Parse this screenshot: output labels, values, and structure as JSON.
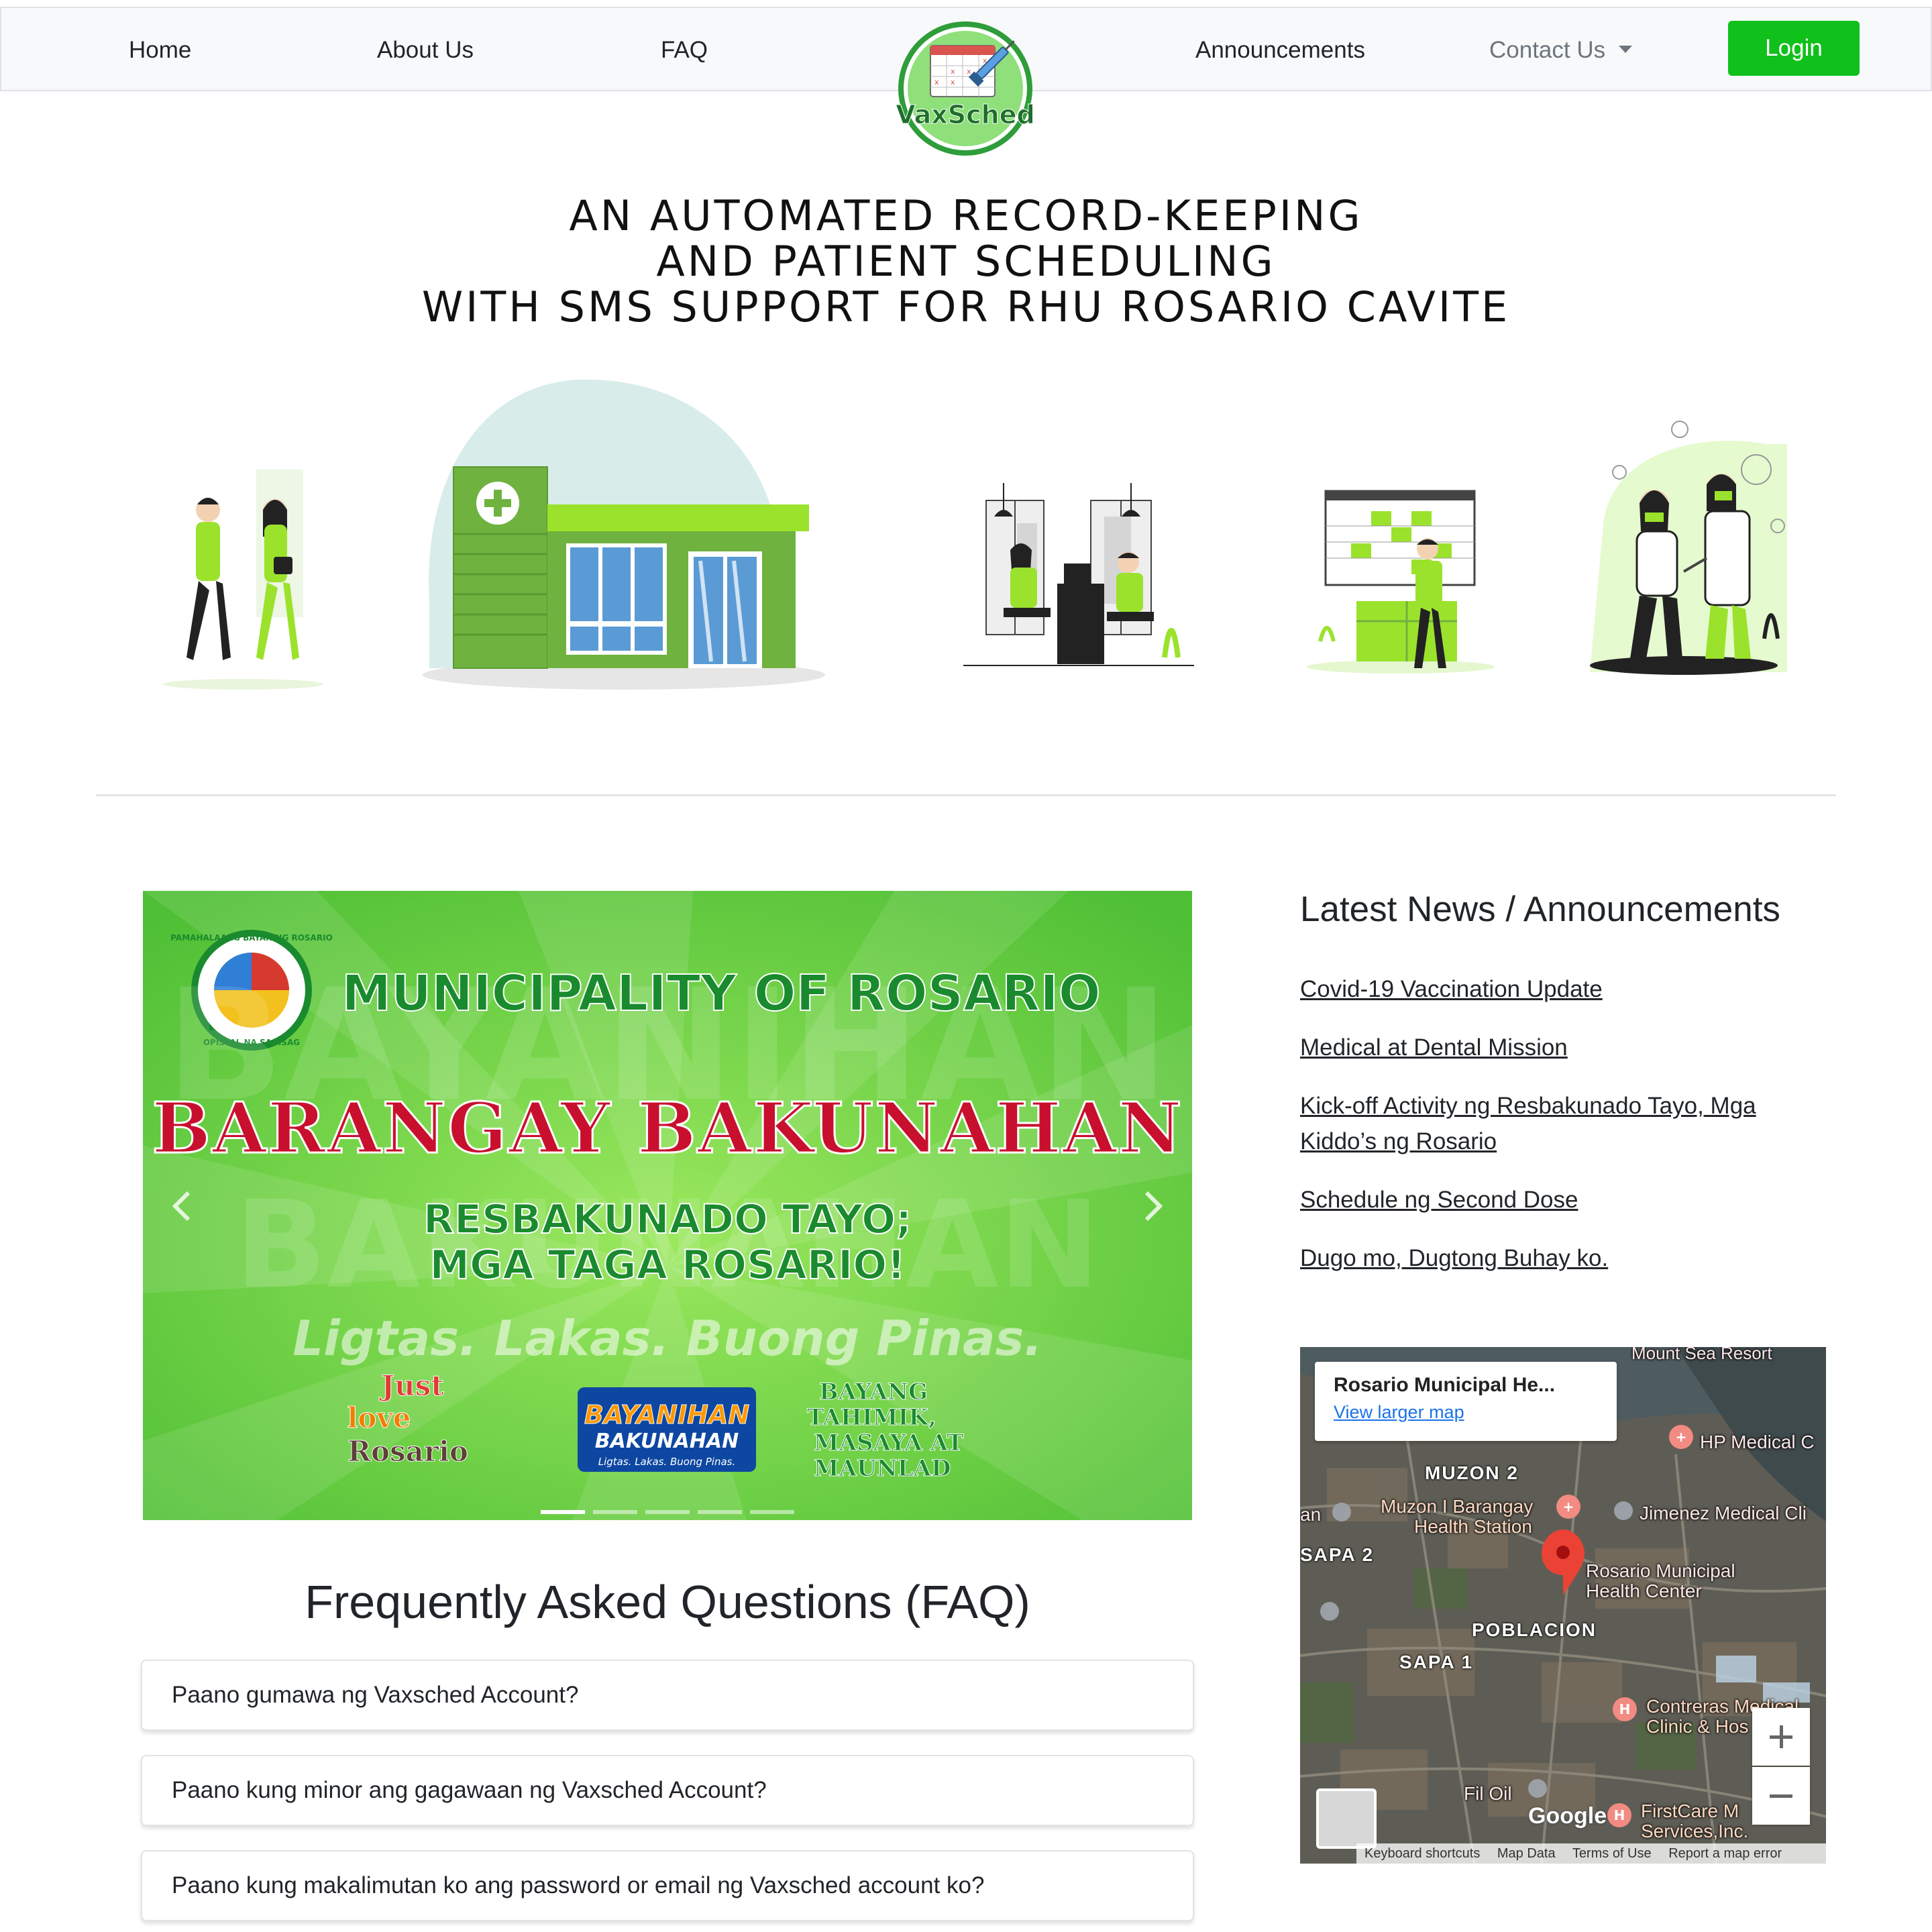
{
  "nav": {
    "home": "Home",
    "about": "About Us",
    "faq": "FAQ",
    "announcements": "Announcements",
    "contact": "Contact Us",
    "login": "Login"
  },
  "logo": {
    "text": "VaxSched"
  },
  "hero": {
    "line1": "AN AUTOMATED RECORD-KEEPING",
    "line2": "AND PATIENT SCHEDULING",
    "line3": "WITH SMS SUPPORT FOR RHU ROSARIO CAVITE"
  },
  "carousel": {
    "slide_count": 5,
    "active_slide": 1,
    "slide": {
      "header": "MUNICIPALITY OF ROSARIO",
      "seal_text_top": "PAMAHALAANG BAYAN NG ROSARIO",
      "seal_text_bottom": "OPISYAL NA SAGISAG",
      "headline": "BARANGAY BAKUNAHAN",
      "sub1": "RESBAKUNADO TAYO;",
      "sub2": "MGA TAGA ROSARIO!",
      "watermark_tagline": "Ligtas. Lakas. Buong Pinas.",
      "badge1_line1": "Just",
      "badge1_line2": "love",
      "badge1_line3": "Rosario",
      "badge2_line1": "BAYANIHAN",
      "badge2_line2": "BAKUNAHAN",
      "badge2_line3": "Ligtas. Lakas. Buong Pinas.",
      "badge3_line1": "BAYANG",
      "badge3_line2": "TAHIMIK,",
      "badge3_line3": "MASAYA AT",
      "badge3_line4": "MAUNLAD"
    }
  },
  "faq": {
    "title": "Frequently Asked Questions (FAQ)",
    "items": [
      "Paano gumawa ng Vaxsched Account?",
      "Paano kung minor ang gagawaan ng Vaxsched Account?",
      "Paano kung makalimutan ko ang password or email ng Vaxsched account ko?"
    ]
  },
  "news": {
    "title": "Latest News / Announcements",
    "items": [
      "Covid-19 Vaccination Update",
      "Medical at Dental Mission",
      "Kick-off Activity ng Resbakunado Tayo, Mga Kiddo’s ng Rosario",
      "Schedule ng Second Dose",
      "Dugo mo, Dugtong Buhay ko."
    ]
  },
  "map": {
    "card_title": "Rosario Municipal He...",
    "card_link": "View larger map",
    "labels": {
      "mount_sea": "Mount Sea Resort",
      "hp_medical": "HP Medical C",
      "muzon2": "MUZON 2",
      "muzon_health_1": "Muzon I Barangay",
      "muzon_health_2": "Health Station",
      "jimenez": "Jimenez Medical Cli",
      "an": "an",
      "sapa2": "SAPA 2",
      "rosario_1": "Rosario Municipal",
      "rosario_2": "Health Center",
      "poblacion": "POBLACION",
      "sapa1": "SAPA 1",
      "contreras_1": "Contreras Medical",
      "contreras_2": "Clinic & Hos",
      "fil_oil": "Fil Oil",
      "firstcare_1": "FirstCare M",
      "firstcare_2": "Services,Inc."
    },
    "google": "Google",
    "footer": {
      "shortcuts": "Keyboard shortcuts",
      "data": "Map Data",
      "terms": "Terms of Use",
      "report": "Report a map error"
    }
  },
  "colors": {
    "accent_green": "#10c01b",
    "illustration_green": "#9be22d",
    "building_green": "#6fb23f",
    "headline_red": "#c8102e",
    "slide_green": "#6fd13c"
  }
}
